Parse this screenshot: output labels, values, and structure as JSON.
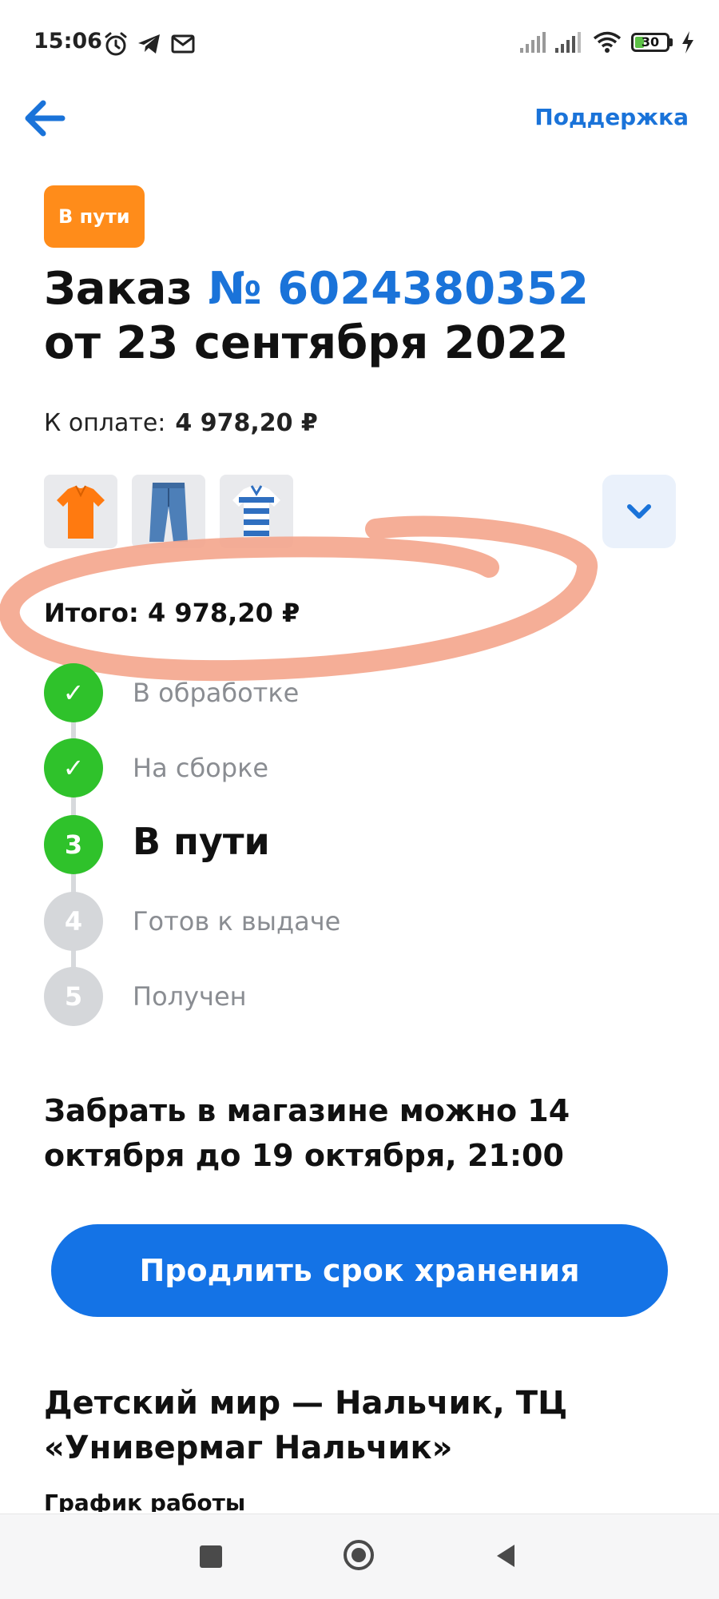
{
  "status_bar": {
    "time": "15:06",
    "battery_level": "30",
    "battery_fraction": 0.3,
    "icons": [
      "alarm-icon",
      "telegram-icon",
      "mail-icon",
      "signal-icon",
      "signal-icon",
      "wifi-icon",
      "battery-icon",
      "charging-icon"
    ]
  },
  "header": {
    "back_icon": "arrow-left-icon",
    "support_label": "Поддержка"
  },
  "order": {
    "status_chip": "В пути",
    "title_prefix": "Заказ",
    "number": "№ 6024380352",
    "date_line": "от 23 сентября 2022",
    "pay_label": "К оплате:",
    "pay_amount": "4 978,20 ₽",
    "thumbnails": [
      "orange-polo-shirt",
      "blue-jeans",
      "striped-polo-shirt"
    ],
    "expand_icon": "chevron-down-icon",
    "total": "Итого: 4 978,20 ₽"
  },
  "timeline": {
    "steps": [
      {
        "marker": "✓",
        "label": "В обработке",
        "state": "done"
      },
      {
        "marker": "✓",
        "label": "На сборке",
        "state": "done"
      },
      {
        "marker": "3",
        "label": "В пути",
        "state": "active"
      },
      {
        "marker": "4",
        "label": "Готов к выдаче",
        "state": "pending"
      },
      {
        "marker": "5",
        "label": "Получен",
        "state": "pending"
      }
    ]
  },
  "pickup": {
    "note": "Забрать в магазине можно 14 октября до 19 октября, 21:00",
    "extend_button": "Продлить срок хранения"
  },
  "store": {
    "name": "Детский мир — Нальчик, ТЦ «Универмаг Нальчик»",
    "hours_label": "График работы"
  },
  "colors": {
    "accent": "#1a73d9",
    "button": "#1473e6",
    "chip": "#ff8c1a",
    "done": "#2fc22b",
    "pending": "#d5d7da",
    "highlight": "#f4a58c"
  }
}
